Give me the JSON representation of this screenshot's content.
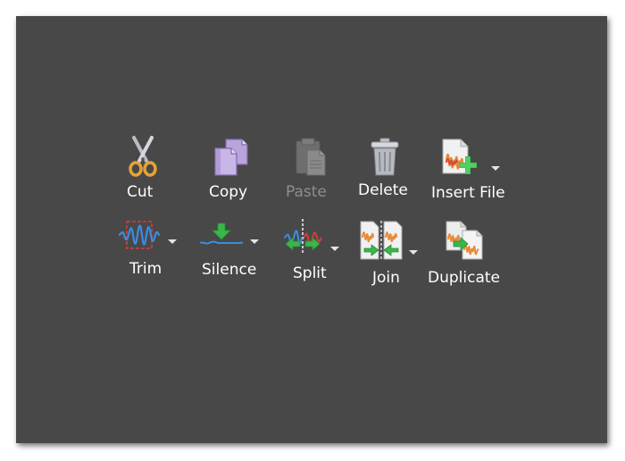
{
  "toolbar": {
    "row1": {
      "cut": {
        "label": "Cut",
        "icon": "scissors-icon",
        "enabled": true
      },
      "copy": {
        "label": "Copy",
        "icon": "copy-icon",
        "enabled": true
      },
      "paste": {
        "label": "Paste",
        "icon": "clipboard-icon",
        "enabled": false
      },
      "delete": {
        "label": "Delete",
        "icon": "trash-icon",
        "enabled": true
      },
      "insert_file": {
        "label": "Insert File",
        "icon": "insert-file-icon",
        "enabled": true,
        "has_dropdown": true
      }
    },
    "row2": {
      "trim": {
        "label": "Trim",
        "icon": "trim-waveform-icon",
        "enabled": true,
        "has_dropdown": true
      },
      "silence": {
        "label": "Silence",
        "icon": "silence-icon",
        "enabled": true,
        "has_dropdown": true
      },
      "split": {
        "label": "Split",
        "icon": "split-icon",
        "enabled": true,
        "has_dropdown": true
      },
      "join": {
        "label": "Join",
        "icon": "join-icon",
        "enabled": true,
        "has_dropdown": true
      },
      "duplicate": {
        "label": "Duplicate",
        "icon": "duplicate-icon",
        "enabled": true
      }
    }
  },
  "colors": {
    "panel_background": "#484848",
    "label_text": "#ffffff",
    "disabled_text": "#8e8e8e"
  }
}
